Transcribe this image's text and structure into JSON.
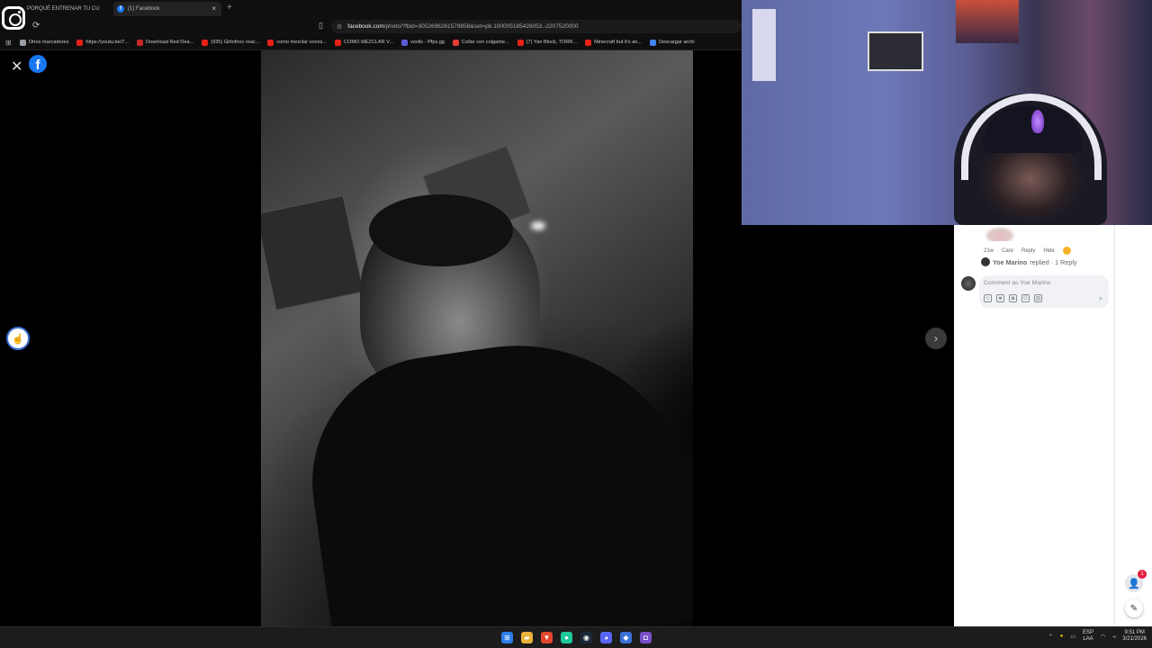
{
  "browser": {
    "tabs": [
      {
        "title": "PORQUÉ ENTRENAR TU CU"
      },
      {
        "title": "(1) Facebook"
      }
    ],
    "new_tab": "+",
    "tab_close": "×",
    "address": {
      "host": "facebook.com",
      "path": "/photo/?fbid=3052696261579858&set=pb.100005185426053.-2207520000"
    },
    "bookmarks": [
      {
        "label": "Otros marcadores",
        "color": "#9aa0a6"
      },
      {
        "label": "https://youtu.be/7...",
        "color": "#e62117"
      },
      {
        "label": "Download Red Dea...",
        "color": "#c62828"
      },
      {
        "label": "(935) Girlofnox reac...",
        "color": "#e62117"
      },
      {
        "label": "como mezclar voces...",
        "color": "#e62117"
      },
      {
        "label": "COMO MEZCLAR V...",
        "color": "#e62117"
      },
      {
        "label": "voxlis - Pfps.gg",
        "color": "#5b5bd6"
      },
      {
        "label": "Collar con colgante...",
        "color": "#e53935"
      },
      {
        "label": "(7) Yan Block, TORR...",
        "color": "#e62117"
      },
      {
        "label": "Minecraft but it's an...",
        "color": "#e62117"
      },
      {
        "label": "Descargar archi",
        "color": "#4285f4"
      }
    ]
  },
  "viewer": {
    "close_label": "✕",
    "fb_letter": "f",
    "prev_label": "☝",
    "next_label": "›"
  },
  "comments": {
    "actions": [
      "21w",
      "Care",
      "Reply",
      "Hide"
    ],
    "reply_user": "Yoe Marino",
    "reply_text": "replied · 1 Reply",
    "placeholder": "Comment as Yoe Marino",
    "contacts_badge": "1"
  },
  "taskbar": {
    "lang": "ESP",
    "lang_sub": "LAA",
    "time": "9:51 PM",
    "date": "3/21/2026"
  },
  "colors": {
    "facebook_blue": "#1877f2",
    "badge_red": "#e41e3f"
  }
}
